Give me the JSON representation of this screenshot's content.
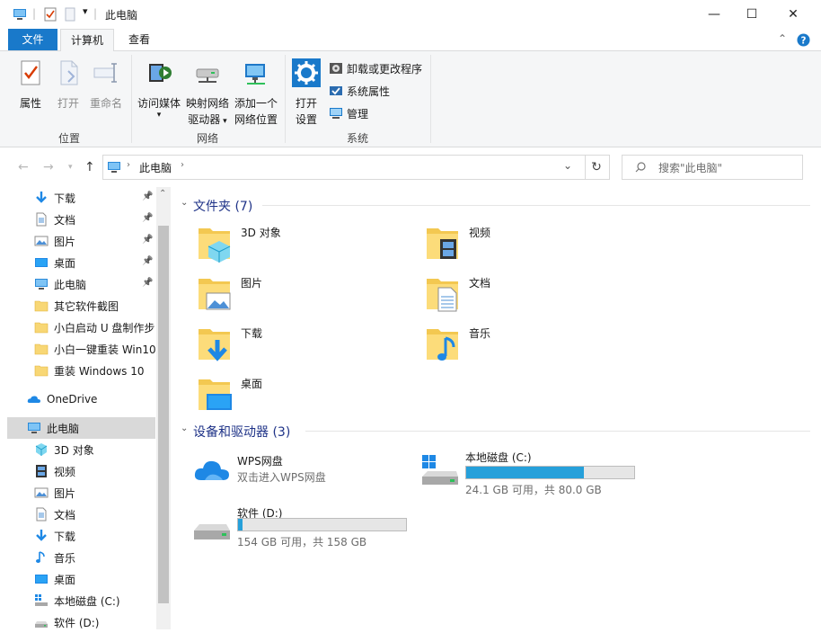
{
  "window": {
    "title": "此电脑",
    "minimize": "—",
    "maximize": "☐",
    "close": "✕"
  },
  "ribbon_tabs": [
    "文件",
    "计算机",
    "查看"
  ],
  "ribbon": {
    "location_group": {
      "label": "位置",
      "properties": "属性",
      "open": "打开",
      "rename": "重命名"
    },
    "network_group": {
      "label": "网络",
      "access_media_l1": "访问媒体",
      "map_drive_l1": "映射网络",
      "map_drive_l2": "驱动器",
      "add_location_l1": "添加一个",
      "add_location_l2": "网络位置"
    },
    "system_group": {
      "label": "系统",
      "open_settings_l1": "打开",
      "open_settings_l2": "设置",
      "uninstall": "卸载或更改程序",
      "system_properties": "系统属性",
      "manage": "管理"
    }
  },
  "address": {
    "path": "此电脑",
    "search_placeholder": "搜索\"此电脑\""
  },
  "nav": {
    "quick": [
      {
        "label": "下载",
        "icon": "download-arrow-icon",
        "pinned": true
      },
      {
        "label": "文档",
        "icon": "document-icon",
        "pinned": true
      },
      {
        "label": "图片",
        "icon": "pictures-icon",
        "pinned": true
      },
      {
        "label": "桌面",
        "icon": "desktop-icon",
        "pinned": true
      },
      {
        "label": "此电脑",
        "icon": "this-pc-icon",
        "pinned": true
      },
      {
        "label": "其它软件截图",
        "icon": "folder-icon",
        "pinned": false
      },
      {
        "label": "小白启动 U 盘制作步",
        "icon": "folder-icon",
        "pinned": false
      },
      {
        "label": "小白一键重装 Win10",
        "icon": "folder-icon",
        "pinned": false
      },
      {
        "label": "重装 Windows 10",
        "icon": "folder-icon",
        "pinned": false
      }
    ],
    "onedrive": "OneDrive",
    "thispc": "此电脑",
    "pc_children": [
      {
        "label": "3D 对象",
        "icon": "3d-objects-icon"
      },
      {
        "label": "视频",
        "icon": "video-icon"
      },
      {
        "label": "图片",
        "icon": "pictures-icon"
      },
      {
        "label": "文档",
        "icon": "document-icon"
      },
      {
        "label": "下载",
        "icon": "download-arrow-icon"
      },
      {
        "label": "音乐",
        "icon": "music-icon"
      },
      {
        "label": "桌面",
        "icon": "desktop-icon"
      },
      {
        "label": "本地磁盘 (C:)",
        "icon": "local-disk-icon"
      },
      {
        "label": "软件 (D:)",
        "icon": "disk-icon"
      }
    ]
  },
  "main": {
    "folders_header": "文件夹 (7)",
    "folders": [
      {
        "label": "3D 对象",
        "icon": "3d-objects-folder-icon"
      },
      {
        "label": "视频",
        "icon": "video-folder-icon"
      },
      {
        "label": "图片",
        "icon": "pictures-folder-icon"
      },
      {
        "label": "文档",
        "icon": "documents-folder-icon"
      },
      {
        "label": "下载",
        "icon": "downloads-folder-icon"
      },
      {
        "label": "音乐",
        "icon": "music-folder-icon"
      },
      {
        "label": "桌面",
        "icon": "desktop-folder-icon"
      }
    ],
    "devices_header": "设备和驱动器 (3)",
    "wps": {
      "label": "WPS网盘",
      "sub": "双击进入WPS网盘"
    },
    "drive_c": {
      "label": "本地磁盘 (C:)",
      "free": "24.1 GB 可用，共 80.0 GB",
      "used_fraction": 0.7
    },
    "drive_d": {
      "label": "软件 (D:)",
      "free": "154 GB 可用，共 158 GB",
      "used_fraction": 0.025
    }
  },
  "colors": {
    "accent": "#1979ca",
    "bar_fill": "#26a0da",
    "header_text": "#1e3287"
  }
}
